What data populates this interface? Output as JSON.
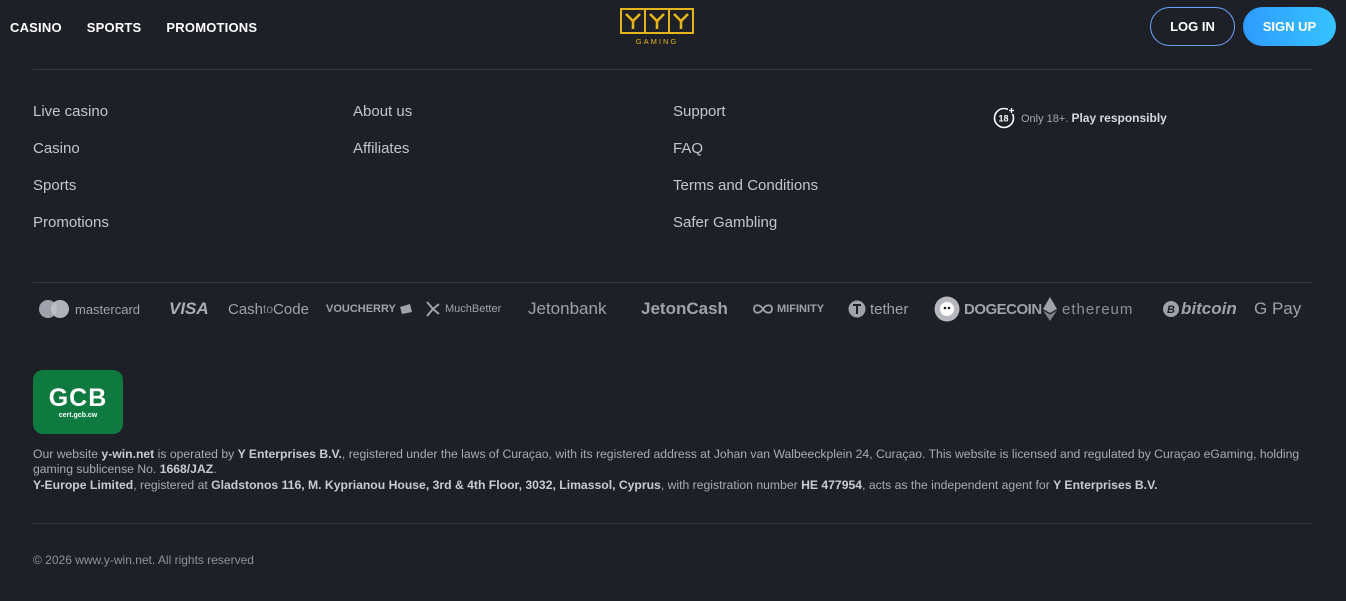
{
  "header": {
    "nav": [
      "CASINO",
      "SPORTS",
      "PROMOTIONS"
    ],
    "logo_text": "GAMING",
    "login_label": "LOG IN",
    "signup_label": "SIGN UP"
  },
  "footer": {
    "col1": [
      "Live casino",
      "Casino",
      "Sports",
      "Promotions"
    ],
    "col2": [
      "About us",
      "Affiliates"
    ],
    "col3": [
      "Support",
      "FAQ",
      "Terms and Conditions",
      "Safer Gambling"
    ],
    "age_badge": "18",
    "age_prefix": "Only 18+.",
    "age_strong": "Play responsibly",
    "payments": {
      "mastercard": "mastercard",
      "visa": "VISA",
      "cashtocode_a": "Cash",
      "cashtocode_b": "to",
      "cashtocode_c": "Code",
      "voucherry": "VOUCHERRY",
      "muchbetter": "MuchBetter",
      "jetonbank": "Jetonbank",
      "jetoncash": "JetonCash",
      "mifinity": "MIFINITY",
      "tether": "tether",
      "dogecoin": "DOGECOIN",
      "ethereum": "ethereum",
      "bitcoin": "bitcoin",
      "gpay": "G Pay"
    },
    "gcb": {
      "big": "GCB",
      "small": "cert.gcb.cw"
    },
    "legal": {
      "l1_a": "Our website ",
      "l1_b": "y-win.net",
      "l1_c": " is operated by ",
      "l1_d": "Y Enterprises B.V.",
      "l1_e": ", registered under the laws of Curaçao, with its registered address at Johan van Walbeeckplein 24, Curaçao. This website is licensed and regulated by Curaçao eGaming, holding gaming sublicense No. ",
      "l1_f": "1668/JAZ",
      "l1_g": ".",
      "l2_a": "Y-Europe Limited",
      "l2_b": ", registered at ",
      "l2_c": "Gladstonos 116, M. Kyprianou House, 3rd & 4th Floor, 3032, Limassol, Cyprus",
      "l2_d": ", with registration number ",
      "l2_e": "HE 477954",
      "l2_f": ", acts as the independent agent for ",
      "l2_g": "Y Enterprises B.V."
    },
    "copyright": "© 2026 www.y-win.net. All rights reserved"
  }
}
